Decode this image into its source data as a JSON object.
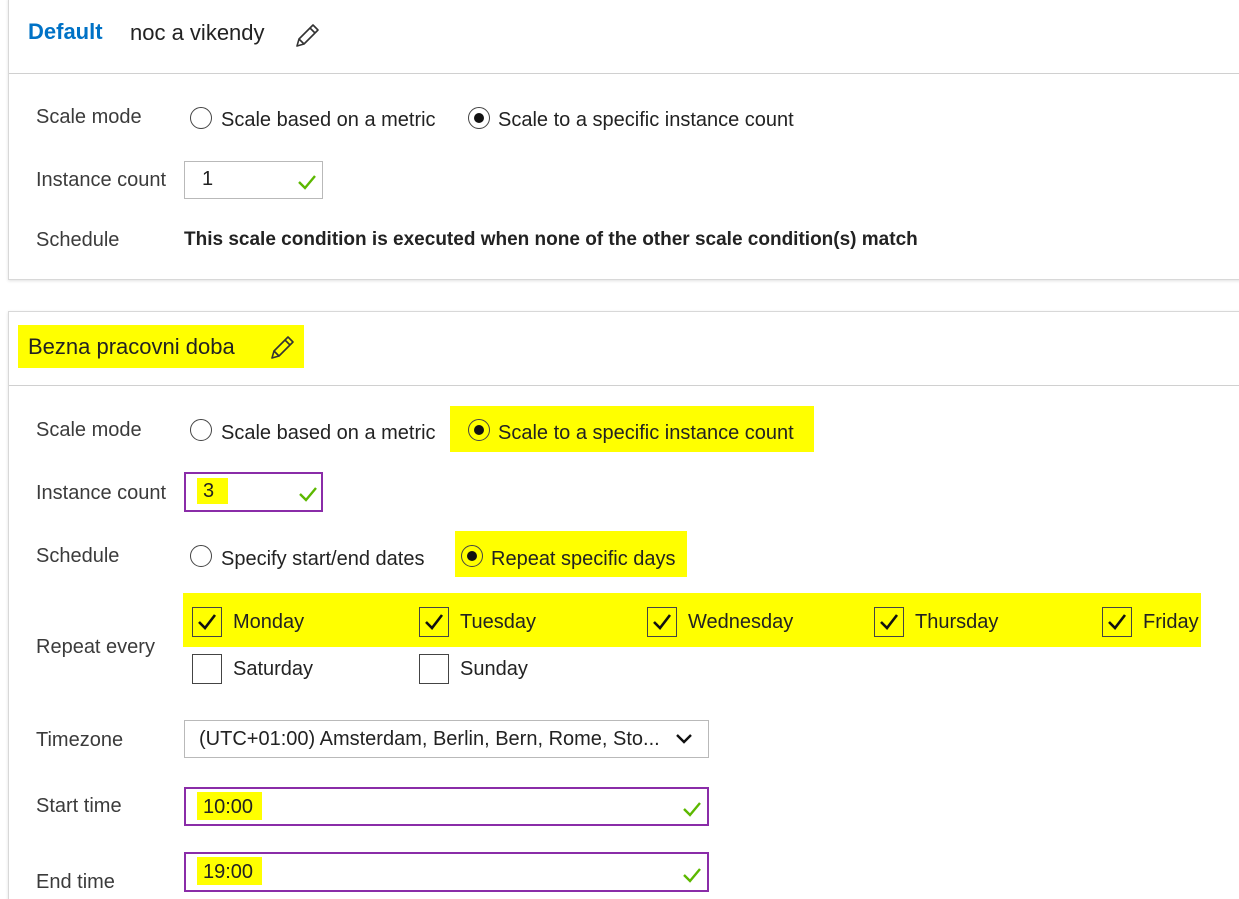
{
  "default_condition": {
    "tag": "Default",
    "name": "noc a vikendy",
    "scale_mode_label": "Scale mode",
    "scale_mode_options": [
      "Scale based on a metric",
      "Scale to a specific instance count"
    ],
    "scale_mode_selected": "Scale to a specific instance count",
    "instance_count_label": "Instance count",
    "instance_count_value": "1",
    "schedule_label": "Schedule",
    "schedule_text": "This scale condition is executed when none of the other scale condition(s) match"
  },
  "condition2": {
    "name": "Bezna pracovni doba",
    "scale_mode_label": "Scale mode",
    "scale_mode_options": [
      "Scale based on a metric",
      "Scale to a specific instance count"
    ],
    "scale_mode_selected": "Scale to a specific instance count",
    "instance_count_label": "Instance count",
    "instance_count_value": "3",
    "schedule_label": "Schedule",
    "schedule_options": [
      "Specify start/end dates",
      "Repeat specific days"
    ],
    "schedule_selected": "Repeat specific days",
    "repeat_label": "Repeat every",
    "days": [
      {
        "label": "Monday",
        "checked": true
      },
      {
        "label": "Tuesday",
        "checked": true
      },
      {
        "label": "Wednesday",
        "checked": true
      },
      {
        "label": "Thursday",
        "checked": true
      },
      {
        "label": "Friday",
        "checked": true
      },
      {
        "label": "Saturday",
        "checked": false
      },
      {
        "label": "Sunday",
        "checked": false
      }
    ],
    "timezone_label": "Timezone",
    "timezone_value": "(UTC+01:00) Amsterdam, Berlin, Bern, Rome, Sto...",
    "start_time_label": "Start time",
    "start_time_value": "10:00",
    "end_time_label": "End time",
    "end_time_value": "19:00"
  },
  "colors": {
    "accent_link": "#0072c6",
    "highlight": "#ffff00",
    "valid_check": "#5cb800",
    "focus_border": "#8a2ca8"
  },
  "icons": [
    "pencil-icon",
    "checkmark-icon",
    "chevron-down-icon"
  ]
}
